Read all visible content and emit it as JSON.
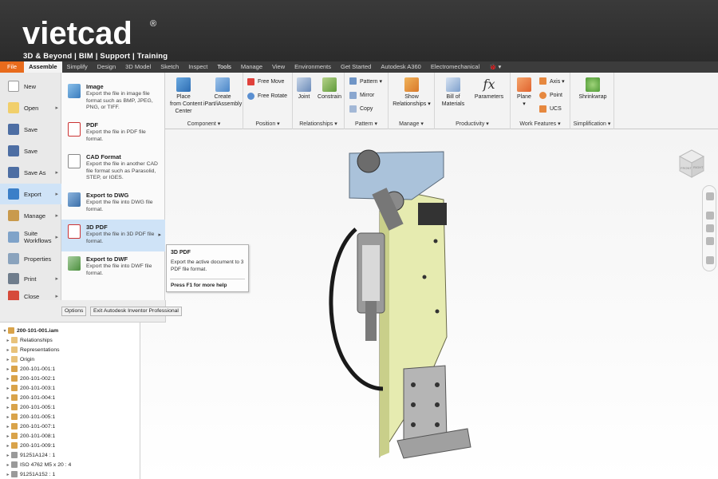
{
  "brand": {
    "logo": "vietcad",
    "reg": "®",
    "tagline": "3D & Beyond | BIM | Support | Training"
  },
  "tabs": [
    "File",
    "Assemble",
    "Simplify",
    "Design",
    "3D Model",
    "Sketch",
    "Inspect",
    "Tools",
    "Manage",
    "View",
    "Environments",
    "Get Started",
    "Autodesk A360",
    "Electromechanical",
    "🐞 ▾"
  ],
  "ribbon": {
    "component": {
      "label": "Component ▾",
      "place": "Place\nfrom Content\nCenter",
      "create": "Create\niPart/iAssembly"
    },
    "position": {
      "label": "Position ▾",
      "free_move": "Free Move",
      "free_rotate": "Free Rotate"
    },
    "relationships": {
      "label": "Relationships ▾",
      "joint": "Joint",
      "constrain": "Constrain"
    },
    "pattern": {
      "label": "Pattern ▾",
      "pattern": "Pattern ▾",
      "mirror": "Mirror",
      "copy": "Copy"
    },
    "manage": {
      "label": "Manage ▾",
      "show": "Show\nRelationships ▾"
    },
    "productivity": {
      "label": "Productivity ▾",
      "bom": "Bill of\nMaterials",
      "params": "Parameters"
    },
    "work_features": {
      "label": "Work Features ▾",
      "plane": "Plane\n▾",
      "axis": "Axis ▾",
      "point": "Point",
      "ucs": "UCS"
    },
    "simplification": {
      "label": "Simplification ▾",
      "shrinkwrap": "Shrinkwrap"
    }
  },
  "file_menu": {
    "items": [
      {
        "label": "New"
      },
      {
        "label": "Open"
      },
      {
        "label": "Save"
      },
      {
        "label": "Save"
      },
      {
        "label": "Save As"
      },
      {
        "label": "Export"
      },
      {
        "label": "Manage"
      },
      {
        "label": "Suite\nWorkflows"
      },
      {
        "label": "Properties"
      },
      {
        "label": "Print"
      },
      {
        "label": "Close"
      }
    ]
  },
  "export_menu": {
    "items": [
      {
        "title": "Image",
        "desc": "Export the file in image file format such as BMP, JPEG, PNG, or TIFF."
      },
      {
        "title": "PDF",
        "desc": "Export the file in PDF file format."
      },
      {
        "title": "CAD Format",
        "desc": "Export the file in another CAD file format such as Parasolid, STEP, or IGES."
      },
      {
        "title": "Export to DWG",
        "desc": "Export the file into DWG file format."
      },
      {
        "title": "3D PDF",
        "desc": "Export the file in 3D PDF file format."
      },
      {
        "title": "Export to DWF",
        "desc": "Export the file into DWF file format."
      }
    ],
    "options": "Options",
    "exit": "Exit Autodesk Inventor Professional"
  },
  "tooltip": {
    "title": "3D PDF",
    "desc": "Export the active document to 3 PDF file format.",
    "help": "Press F1 for more help"
  },
  "browser": {
    "rows": [
      {
        "label": "200-101-001.iam"
      },
      {
        "label": "Relationships"
      },
      {
        "label": "Representations"
      },
      {
        "label": "Origin"
      },
      {
        "label": "200-101-001:1"
      },
      {
        "label": "200-101-002:1"
      },
      {
        "label": "200-101-003:1"
      },
      {
        "label": "200-101-004:1"
      },
      {
        "label": "200-101-005:1"
      },
      {
        "label": "200-101-005:1"
      },
      {
        "label": "200-101-007:1"
      },
      {
        "label": "200-101-008:1"
      },
      {
        "label": "200-101-009:1"
      },
      {
        "label": "91251A124 : 1"
      },
      {
        "label": "ISO 4762 M5 x 20 : 4"
      },
      {
        "label": "91251A152 : 1"
      }
    ]
  },
  "viewcube": {
    "front": "FRONT",
    "right": "RIGHT"
  },
  "colors": {
    "file_tab": "#e86b1c",
    "selection": "#cfe3f7",
    "model_yellow": "#e8ecaa",
    "model_blue": "#a9c0d8"
  }
}
